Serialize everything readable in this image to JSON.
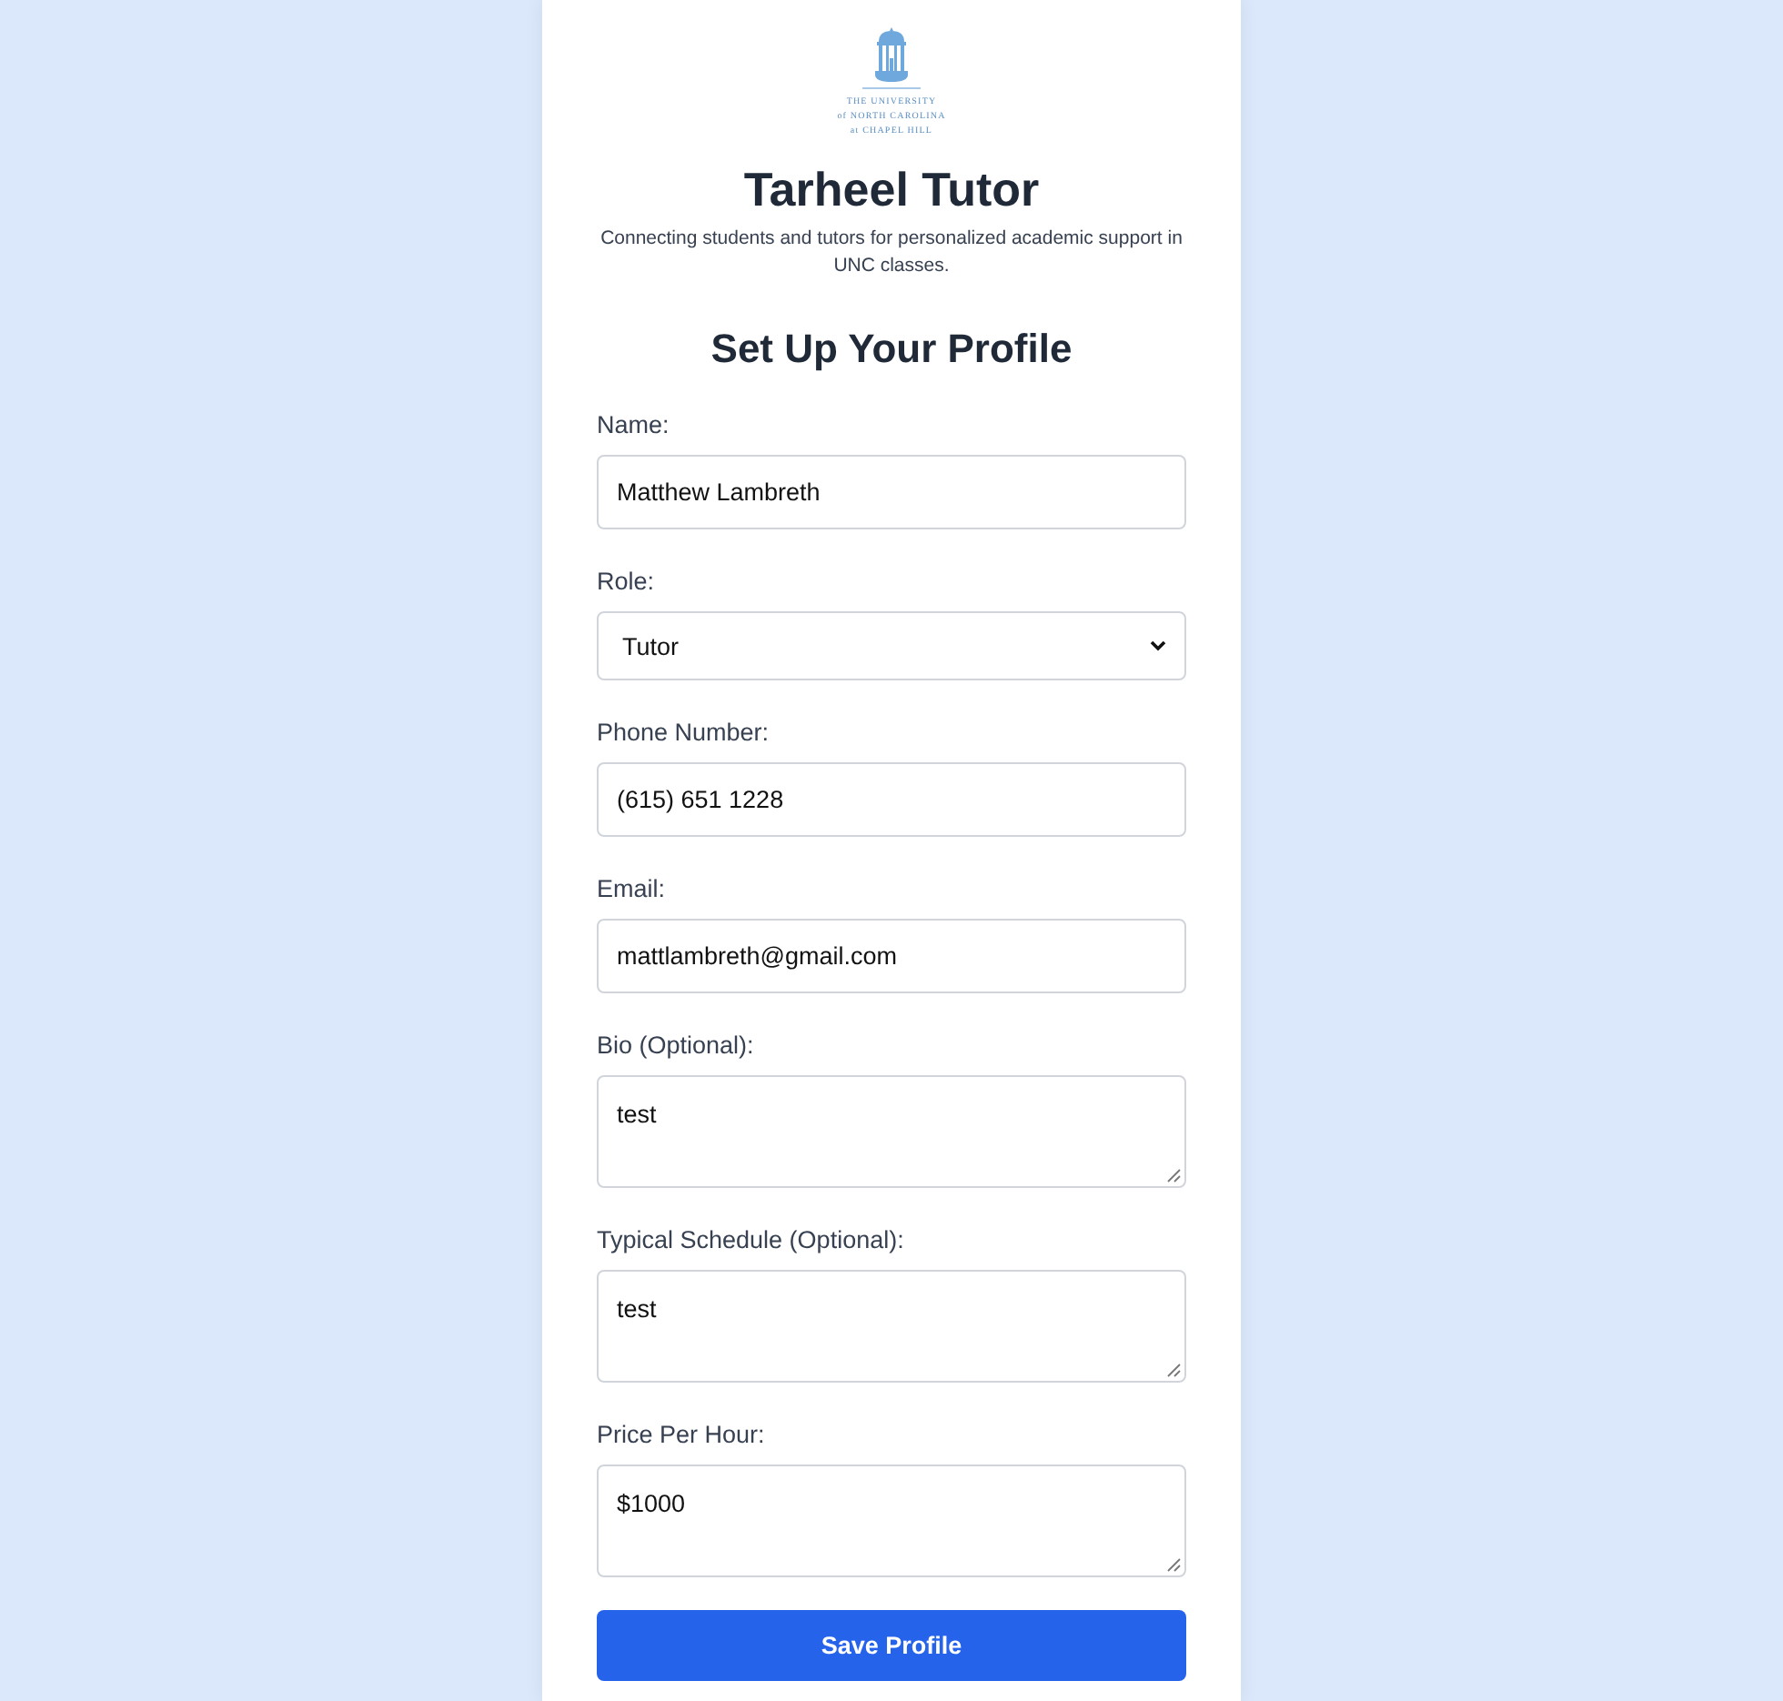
{
  "logo": {
    "lines": [
      "THE UNIVERSITY",
      "of NORTH CAROLINA",
      "at CHAPEL HILL"
    ]
  },
  "header": {
    "title": "Tarheel Tutor",
    "subtitle": "Connecting students and tutors for personalized academic support in UNC classes."
  },
  "form": {
    "title": "Set Up Your Profile",
    "fields": [
      {
        "kind": "text",
        "label": "Name:",
        "value": "Matthew Lambreth"
      },
      {
        "kind": "select",
        "label": "Role:",
        "value": "Tutor"
      },
      {
        "kind": "text",
        "label": "Phone Number:",
        "value": "(615) 651 1228"
      },
      {
        "kind": "text",
        "label": "Email:",
        "value": "mattlambreth@gmail.com"
      },
      {
        "kind": "textarea",
        "label": "Bio (Optional):",
        "value": "test"
      },
      {
        "kind": "textarea",
        "label": "Typical Schedule (Optional):",
        "value": "test"
      },
      {
        "kind": "textarea",
        "label": "Price Per Hour:",
        "value": "$1000"
      }
    ],
    "submit": "Save Profile"
  }
}
